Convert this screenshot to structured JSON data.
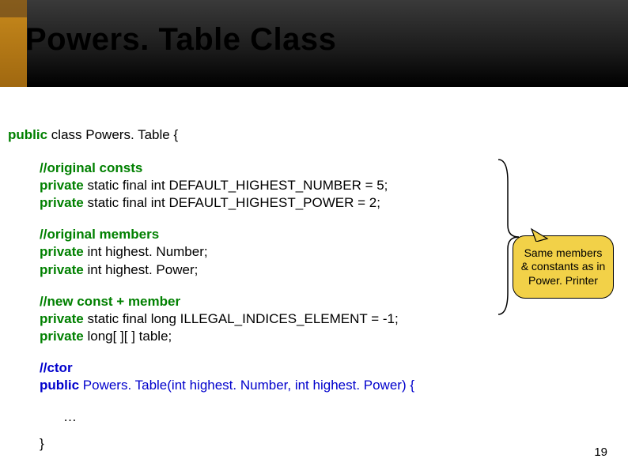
{
  "title": "Powers. Table Class",
  "code": {
    "classDecl_public": "public",
    "classDecl_class": "class",
    "classDecl_name": "Powers. Table {",
    "comment_consts": "//original consts",
    "line_const1_priv": "private",
    "line_const1_rest": " static final int DEFAULT_HIGHEST_NUMBER = 5;",
    "line_const2_priv": "private",
    "line_const2_rest": " static final int DEFAULT_HIGHEST_POWER = 2;",
    "comment_members": "//original members",
    "line_mem1_priv": "private",
    "line_mem1_rest": " int highest. Number;",
    "line_mem2_priv": "private",
    "line_mem2_rest": " int highest. Power;",
    "comment_new": "//new const + member",
    "line_new1_priv": "private",
    "line_new1_rest": " static final long ILLEGAL_INDICES_ELEMENT = -1;",
    "line_new2_priv": "private",
    "line_new2_rest": " long[ ][ ] table;",
    "comment_ctor": "//ctor",
    "line_ctor_pub": "public",
    "line_ctor_rest": " Powers. Table(int highest. Number, int highest. Power) {",
    "ellipsis": "…",
    "close": "}"
  },
  "callout": {
    "line1": "Same members",
    "line2": "& constants as in",
    "line3": "Power. Printer"
  },
  "pageNumber": "19"
}
